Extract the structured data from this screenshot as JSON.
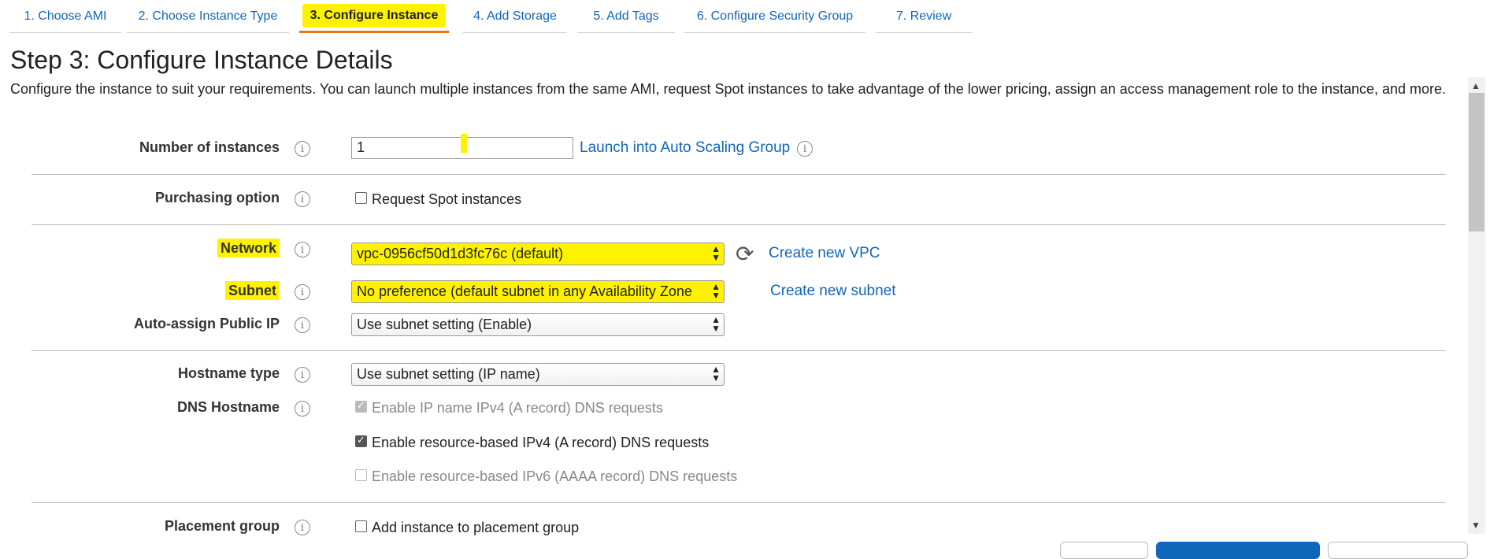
{
  "tabs": [
    {
      "label": "1. Choose AMI"
    },
    {
      "label": "2. Choose Instance Type"
    },
    {
      "label": "3. Configure Instance"
    },
    {
      "label": "4. Add Storage"
    },
    {
      "label": "5. Add Tags"
    },
    {
      "label": "6. Configure Security Group"
    },
    {
      "label": "7. Review"
    }
  ],
  "page": {
    "title": "Step 3: Configure Instance Details",
    "description": "Configure the instance to suit your requirements. You can launch multiple instances from the same AMI, request Spot instances to take advantage of the lower pricing, assign an access management role to the instance, and more."
  },
  "fields": {
    "num_instances": {
      "label": "Number of instances",
      "value": "1",
      "link": "Launch into Auto Scaling Group"
    },
    "purchasing": {
      "label": "Purchasing option",
      "checkbox": "Request Spot instances"
    },
    "network": {
      "label": "Network",
      "value": "vpc-0956cf50d1d3fc76c (default)",
      "link": "Create new VPC"
    },
    "subnet": {
      "label": "Subnet",
      "value": "No preference (default subnet in any Availability Zone",
      "link": "Create new subnet"
    },
    "public_ip": {
      "label": "Auto-assign Public IP",
      "value": "Use subnet setting (Enable)"
    },
    "hostname_type": {
      "label": "Hostname type",
      "value": "Use subnet setting (IP name)"
    },
    "dns_hostname": {
      "label": "DNS Hostname",
      "options": [
        {
          "label": "Enable IP name IPv4 (A record) DNS requests"
        },
        {
          "label": "Enable resource-based IPv4 (A record) DNS requests"
        },
        {
          "label": "Enable resource-based IPv6 (AAAA record) DNS requests"
        }
      ]
    },
    "placement": {
      "label": "Placement group",
      "checkbox": "Add instance to placement group"
    }
  },
  "icons": {
    "info": "i",
    "refresh": "⟳",
    "scroll_up": "▲",
    "scroll_down": "▼"
  },
  "colors": {
    "highlight": "#fff200",
    "link": "#1066bb",
    "active_tab_border": "#ec7211"
  }
}
